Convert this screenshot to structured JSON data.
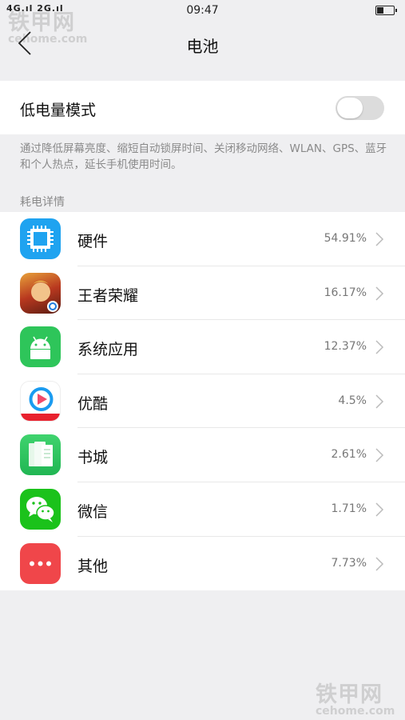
{
  "status_bar": {
    "signal_text": "4G.ıl 2G.ıl",
    "time": "09:47"
  },
  "nav": {
    "title": "电池"
  },
  "low_power": {
    "label": "低电量模式",
    "enabled": false,
    "description": "通过降低屏幕亮度、缩短自动锁屏时间、关闭移动网络、WLAN、GPS、蓝牙和个人热点，延长手机使用时间。"
  },
  "usage": {
    "header": "耗电详情",
    "items": [
      {
        "name": "硬件",
        "percent": "54.91%",
        "icon": "hardware-chip-icon",
        "color": "#1fa3f0"
      },
      {
        "name": "王者荣耀",
        "percent": "16.17%",
        "icon": "honor-of-kings-icon",
        "color": "#b8381f"
      },
      {
        "name": "系统应用",
        "percent": "12.37%",
        "icon": "android-icon",
        "color": "#2ec55a"
      },
      {
        "name": "优酷",
        "percent": "4.5%",
        "icon": "youku-icon",
        "color": "#1a9bf0"
      },
      {
        "name": "书城",
        "percent": "2.61%",
        "icon": "bookstore-icon",
        "color": "#33c863"
      },
      {
        "name": "微信",
        "percent": "1.71%",
        "icon": "wechat-icon",
        "color": "#1bc21b"
      },
      {
        "name": "其他",
        "percent": "7.73%",
        "icon": "more-dots-icon",
        "color": "#f0464a"
      }
    ]
  },
  "watermark": {
    "brand": "铁甲网",
    "site": "cehome.com"
  }
}
